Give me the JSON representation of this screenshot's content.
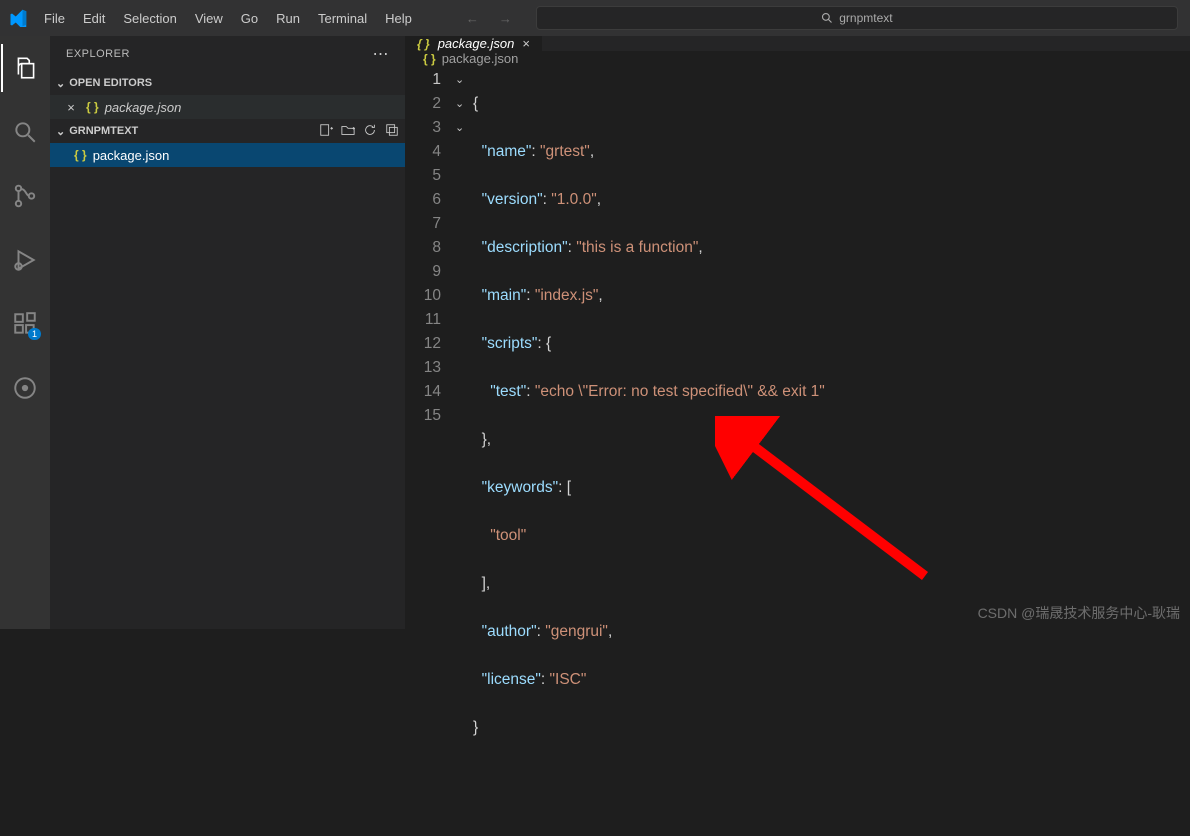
{
  "menu": {
    "file": "File",
    "edit": "Edit",
    "selection": "Selection",
    "view": "View",
    "go": "Go",
    "run": "Run",
    "terminal": "Terminal",
    "help": "Help"
  },
  "search": {
    "value": "grnpmtext"
  },
  "sidebar": {
    "title": "EXPLORER",
    "openEditors": "OPEN EDITORS",
    "openFile": "package.json",
    "project": "GRNPMTEXT",
    "file": "package.json"
  },
  "tab": {
    "name": "package.json"
  },
  "breadcrumb": {
    "file": "package.json"
  },
  "activity": {
    "badge": "1"
  },
  "code": {
    "l1": "{",
    "l2": {
      "k": "\"name\"",
      "v": "\"grtest\""
    },
    "l3": {
      "k": "\"version\"",
      "v": "\"1.0.0\""
    },
    "l4": {
      "k": "\"description\"",
      "v": "\"this is a function\""
    },
    "l5": {
      "k": "\"main\"",
      "v": "\"index.js\""
    },
    "l6": {
      "k": "\"scripts\""
    },
    "l7": {
      "k": "\"test\"",
      "v": "\"echo \\\"Error: no test specified\\\" && exit 1\""
    },
    "l9": {
      "k": "\"keywords\""
    },
    "l10": {
      "v": "\"tool\""
    },
    "l12": {
      "k": "\"author\"",
      "v": "\"gengrui\""
    },
    "l13": {
      "k": "\"license\"",
      "v": "\"ISC\""
    }
  },
  "lineNumbers": [
    "1",
    "2",
    "3",
    "4",
    "5",
    "6",
    "7",
    "8",
    "9",
    "10",
    "11",
    "12",
    "13",
    "14",
    "15"
  ],
  "watermark": "CSDN @瑞晟技术服务中心-耿瑞"
}
